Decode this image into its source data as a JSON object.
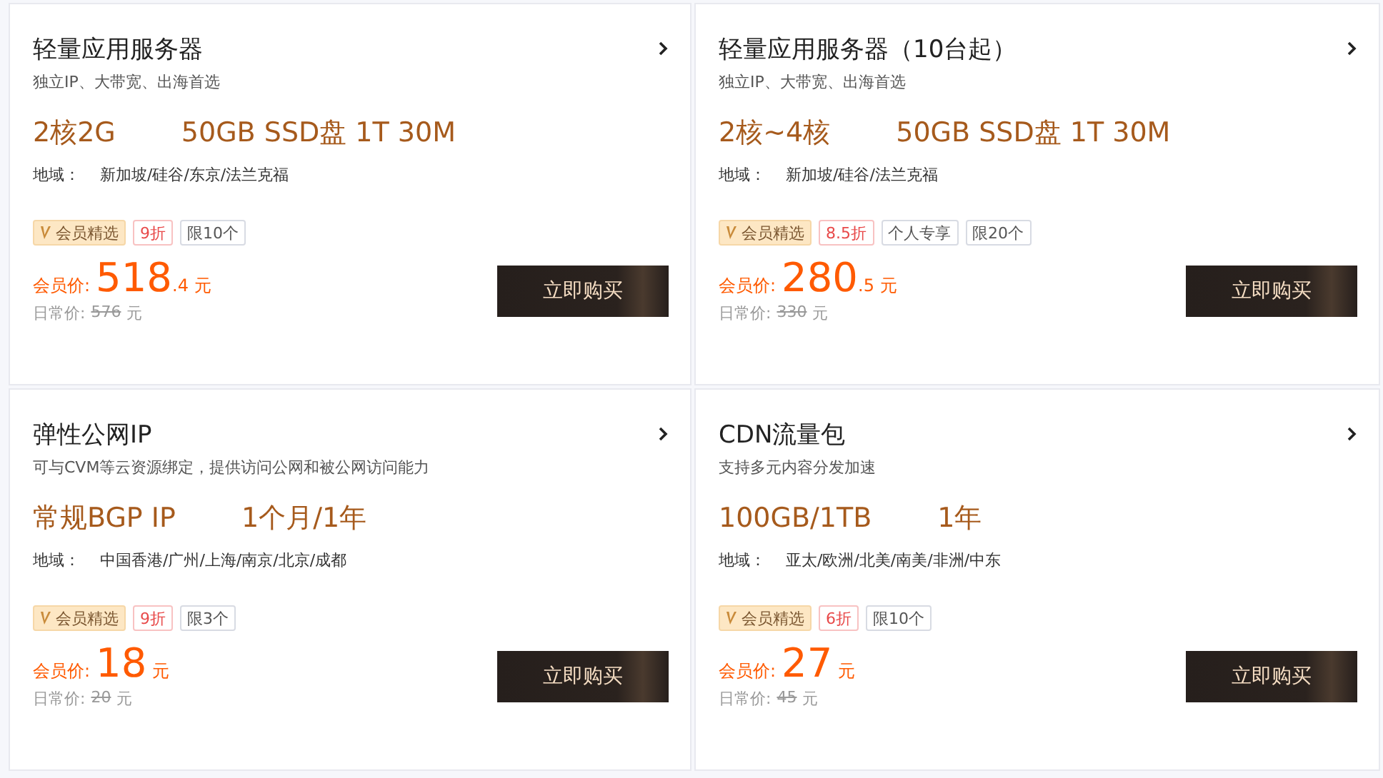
{
  "products": [
    {
      "title": "轻量应用服务器",
      "subtitle": "独立IP、大带宽、出海首选",
      "specs": [
        "2核2G",
        "50GB SSD盘 1T 30M"
      ],
      "region_label": "地域：",
      "region": "新加坡/硅谷/东京/法兰克福",
      "tags": [
        {
          "kind": "member",
          "label": "会员精选"
        },
        {
          "kind": "discount",
          "label": "9折"
        },
        {
          "kind": "plain",
          "label": "限10个"
        }
      ],
      "price_label": "会员价:",
      "price_int": "518",
      "price_dec": ".4",
      "price_unit": "元",
      "regular_label": "日常价:",
      "regular_value": "576",
      "regular_unit": "元",
      "button": "立即购买"
    },
    {
      "title": "轻量应用服务器（10台起）",
      "subtitle": "独立IP、大带宽、出海首选",
      "specs": [
        "2核~4核",
        "50GB SSD盘 1T 30M"
      ],
      "region_label": "地域：",
      "region": "新加坡/硅谷/法兰克福",
      "tags": [
        {
          "kind": "member",
          "label": "会员精选"
        },
        {
          "kind": "discount",
          "label": "8.5折"
        },
        {
          "kind": "plain",
          "label": "个人专享"
        },
        {
          "kind": "plain",
          "label": "限20个"
        }
      ],
      "price_label": "会员价:",
      "price_int": "280",
      "price_dec": ".5",
      "price_unit": "元",
      "regular_label": "日常价:",
      "regular_value": "330",
      "regular_unit": "元",
      "button": "立即购买"
    },
    {
      "title": "弹性公网IP",
      "subtitle": "可与CVM等云资源绑定，提供访问公网和被公网访问能力",
      "specs": [
        "常规BGP IP",
        "1个月/1年"
      ],
      "region_label": "地域：",
      "region": "中国香港/广州/上海/南京/北京/成都",
      "tags": [
        {
          "kind": "member",
          "label": "会员精选"
        },
        {
          "kind": "discount",
          "label": "9折"
        },
        {
          "kind": "plain",
          "label": "限3个"
        }
      ],
      "price_label": "会员价:",
      "price_int": "18",
      "price_unit": "元",
      "regular_label": "日常价:",
      "regular_value": "20",
      "regular_unit": "元",
      "button": "立即购买"
    },
    {
      "title": "CDN流量包",
      "subtitle": "支持多元内容分发加速",
      "specs": [
        "100GB/1TB",
        "1年"
      ],
      "region_label": "地域：",
      "region": "亚太/欧洲/北美/南美/非洲/中东",
      "tags": [
        {
          "kind": "member",
          "label": "会员精选"
        },
        {
          "kind": "discount",
          "label": "6折"
        },
        {
          "kind": "plain",
          "label": "限10个"
        }
      ],
      "price_label": "会员价:",
      "price_int": "27",
      "price_unit": "元",
      "regular_label": "日常价:",
      "regular_value": "45",
      "regular_unit": "元",
      "button": "立即购买"
    }
  ]
}
